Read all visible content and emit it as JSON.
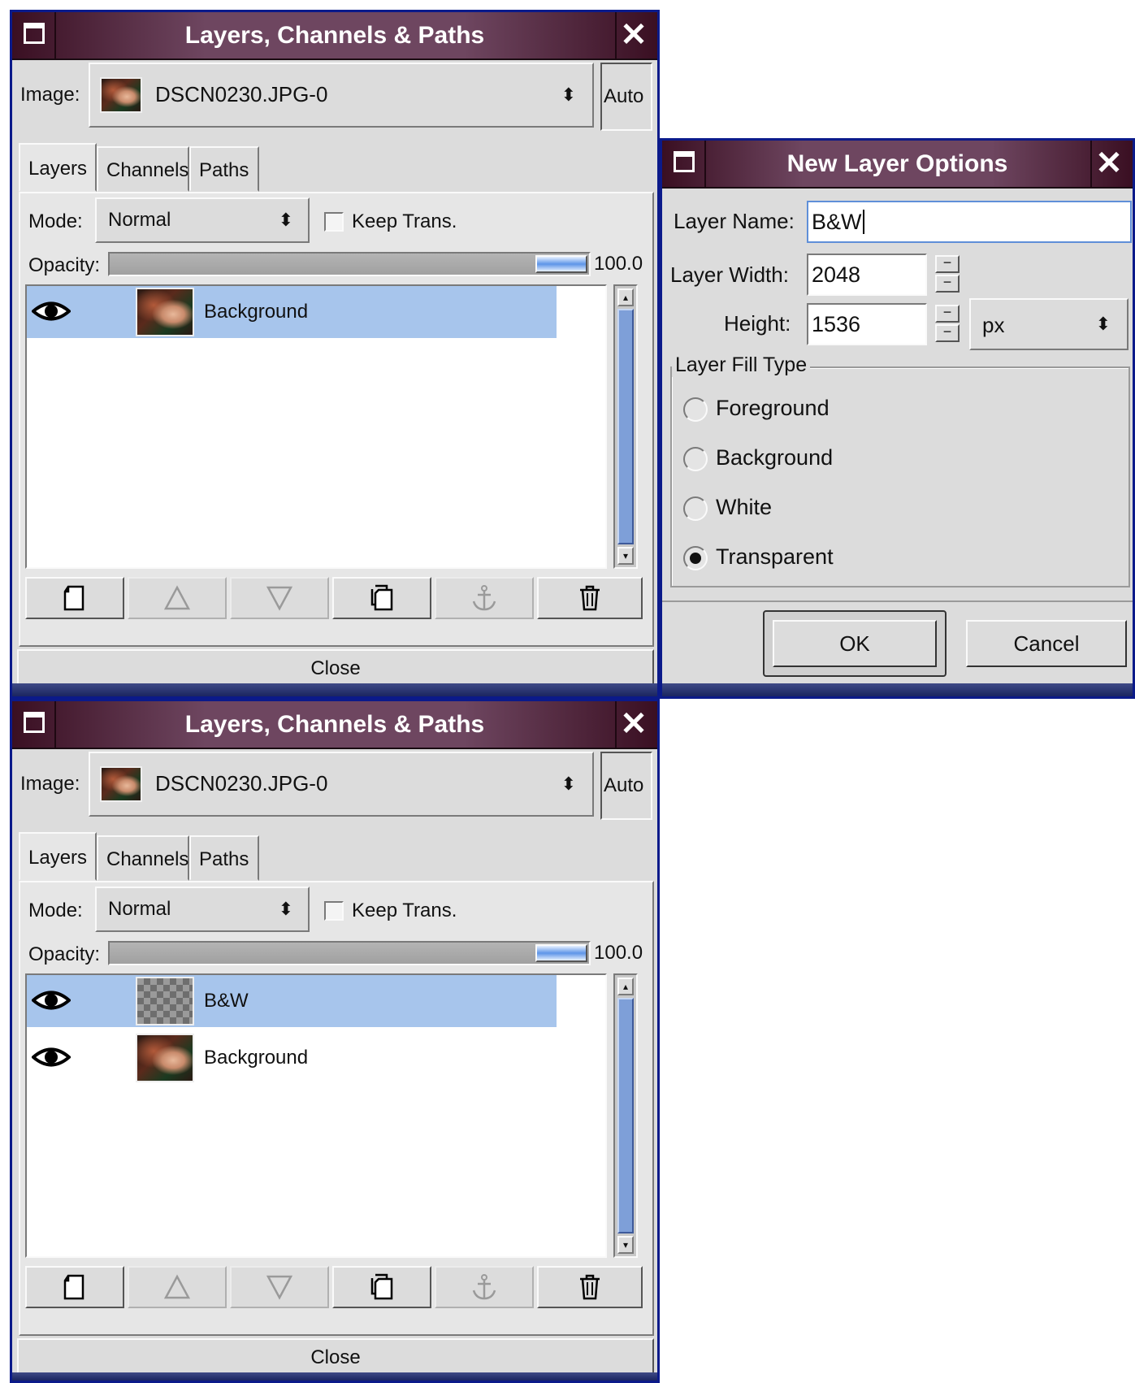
{
  "layers_dialog_top": {
    "title": "Layers, Channels & Paths",
    "image_label": "Image:",
    "image_value": "DSCN0230.JPG-0",
    "auto_label": "Auto",
    "tabs": [
      "Layers",
      "Channels",
      "Paths"
    ],
    "mode_label": "Mode:",
    "mode_value": "Normal",
    "keep_trans_label": "Keep Trans.",
    "opacity_label": "Opacity:",
    "opacity_value": "100.0",
    "layers": [
      {
        "name": "Background",
        "visible": true,
        "selected": true
      }
    ],
    "close_label": "Close"
  },
  "layers_dialog_bottom": {
    "title": "Layers, Channels & Paths",
    "image_label": "Image:",
    "image_value": "DSCN0230.JPG-0",
    "auto_label": "Auto",
    "tabs": [
      "Layers",
      "Channels",
      "Paths"
    ],
    "mode_label": "Mode:",
    "mode_value": "Normal",
    "keep_trans_label": "Keep Trans.",
    "opacity_label": "Opacity:",
    "opacity_value": "100.0",
    "layers": [
      {
        "name": "B&W",
        "visible": true,
        "selected": true
      },
      {
        "name": "Background",
        "visible": true,
        "selected": false
      }
    ],
    "close_label": "Close"
  },
  "new_layer_dialog": {
    "title": "New Layer Options",
    "name_label": "Layer Name:",
    "name_value": "B&W",
    "width_label": "Layer Width:",
    "width_value": "2048",
    "height_label": "Height:",
    "height_value": "1536",
    "unit_value": "px",
    "fill_type_label": "Layer Fill Type",
    "fill_options": [
      "Foreground",
      "Background",
      "White",
      "Transparent"
    ],
    "fill_selected": "Transparent",
    "ok_label": "OK",
    "cancel_label": "Cancel"
  },
  "icons": {
    "toolbar": [
      "new-layer-icon",
      "raise-layer-icon",
      "lower-layer-icon",
      "duplicate-layer-icon",
      "anchor-icon",
      "delete-icon"
    ],
    "eye": "eye-icon"
  },
  "colors": {
    "titlebar": "#6e4660",
    "selection": "#a7c5ec",
    "window_border": "#0b1a8a"
  }
}
